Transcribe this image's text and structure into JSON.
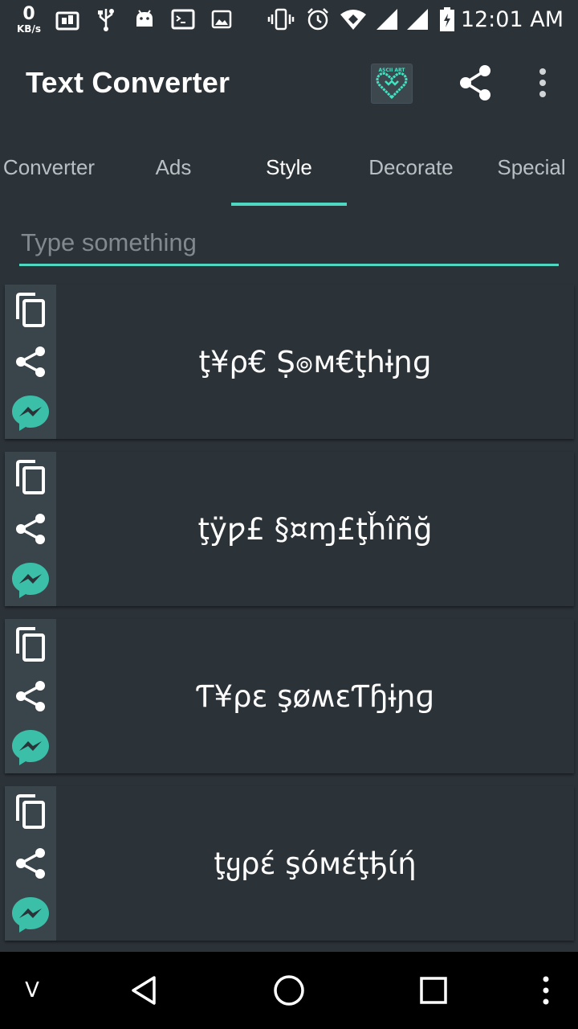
{
  "status_bar": {
    "net_speed_value": "0",
    "net_speed_unit": "KB/s",
    "time": "12:01 AM",
    "icons": [
      "screen-mirror-icon",
      "usb-icon",
      "android-icon",
      "terminal-icon",
      "image-icon",
      "vibrate-icon",
      "alarm-icon",
      "wifi-icon",
      "signal-icon",
      "signal-icon-2",
      "battery-charging-icon"
    ]
  },
  "app_bar": {
    "title": "Text Converter",
    "logo_text": "ASCII ART",
    "share_icon": "share-icon",
    "more_icon": "more-vertical-icon"
  },
  "tabs": [
    {
      "label": "Converter"
    },
    {
      "label": "Ads"
    },
    {
      "label": "Style",
      "active": true
    },
    {
      "label": "Decorate"
    },
    {
      "label": "Special"
    }
  ],
  "input": {
    "value": "",
    "placeholder": "Type something"
  },
  "results": [
    {
      "text": "ţ¥ρ€ Ṣ๏м€ţhɨɲɡ"
    },
    {
      "text": "ţÿƿ£ §¤ɱ£ţȟîñğ"
    },
    {
      "text": "Ƭ¥ρɛ şøʍɛƬɧɨɲɡ"
    },
    {
      "text": "ţყρέ şόмέţђίή"
    }
  ],
  "card_actions": {
    "copy_icon": "copy-icon",
    "share_icon": "share-icon",
    "messenger_icon": "messenger-icon"
  },
  "nav_bar": {
    "extra_label": "V",
    "back_icon": "back-icon",
    "home_icon": "home-icon",
    "recents_icon": "recents-icon",
    "menu_icon": "more-vertical-icon"
  },
  "colors": {
    "accent": "#4fd8c1",
    "background": "#2b3238",
    "side_panel": "#3a454b",
    "messenger": "#3bbfa8"
  }
}
